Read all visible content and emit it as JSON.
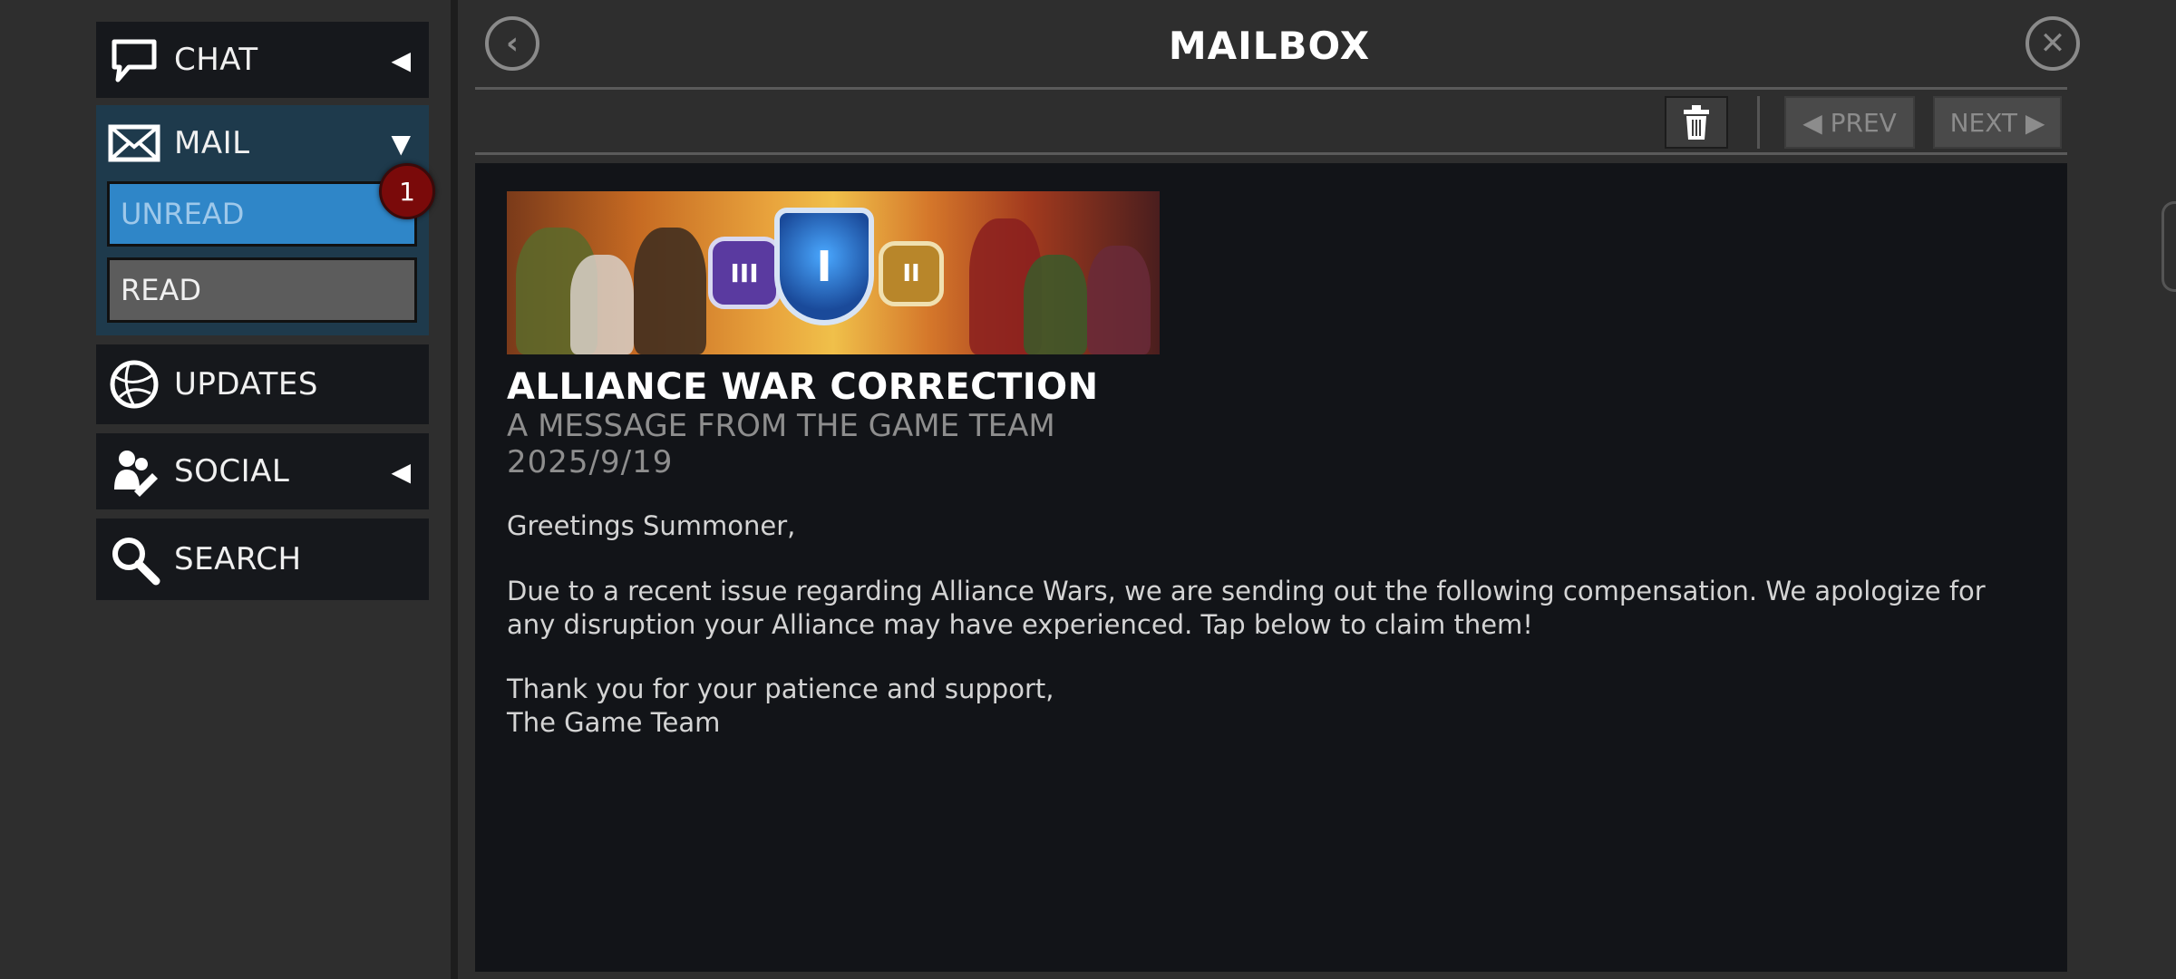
{
  "sidebar": {
    "chat": {
      "label": "CHAT",
      "icon": "chat-bubble-icon",
      "arrow": "◀"
    },
    "mail": {
      "label": "MAIL",
      "icon": "envelope-icon",
      "arrow": "▼",
      "sub_items": [
        {
          "label": "UNREAD"
        },
        {
          "label": "READ"
        }
      ],
      "unread_count": "1"
    },
    "updates": {
      "label": "UPDATES",
      "icon": "globe-icon"
    },
    "social": {
      "label": "SOCIAL",
      "icon": "people-icon",
      "arrow": "◀"
    },
    "search": {
      "label": "SEARCH",
      "icon": "magnifier-icon"
    }
  },
  "header": {
    "title": "MAILBOX",
    "back_icon": "back-arrow-icon",
    "close_icon": "close-icon"
  },
  "toolbar": {
    "delete_icon": "trash-icon",
    "prev_label": "◀ PREV",
    "next_label": "NEXT ▶"
  },
  "message": {
    "banner_image": "alliance-war-banner",
    "title": "ALLIANCE WAR CORRECTION",
    "subtitle": "A MESSAGE FROM THE GAME TEAM",
    "date": "2025/9/19",
    "greeting": "Greetings Summoner,",
    "paragraph1": "Due to a recent issue regarding Alliance Wars, we are sending out the following compensation. We apologize for any disruption your Alliance may have experienced. Tap below to claim them!",
    "closing_line1": "Thank you for your patience and support,",
    "closing_line2": "The Game Team"
  },
  "colors": {
    "background": "#2e2e2e",
    "panel": "#121418",
    "nav_item": "#16181c",
    "mail_group": "#1e3a4c",
    "unread_active": "#2f86c8",
    "read_item": "#5c5c5c",
    "badge": "#7a0a0a"
  }
}
